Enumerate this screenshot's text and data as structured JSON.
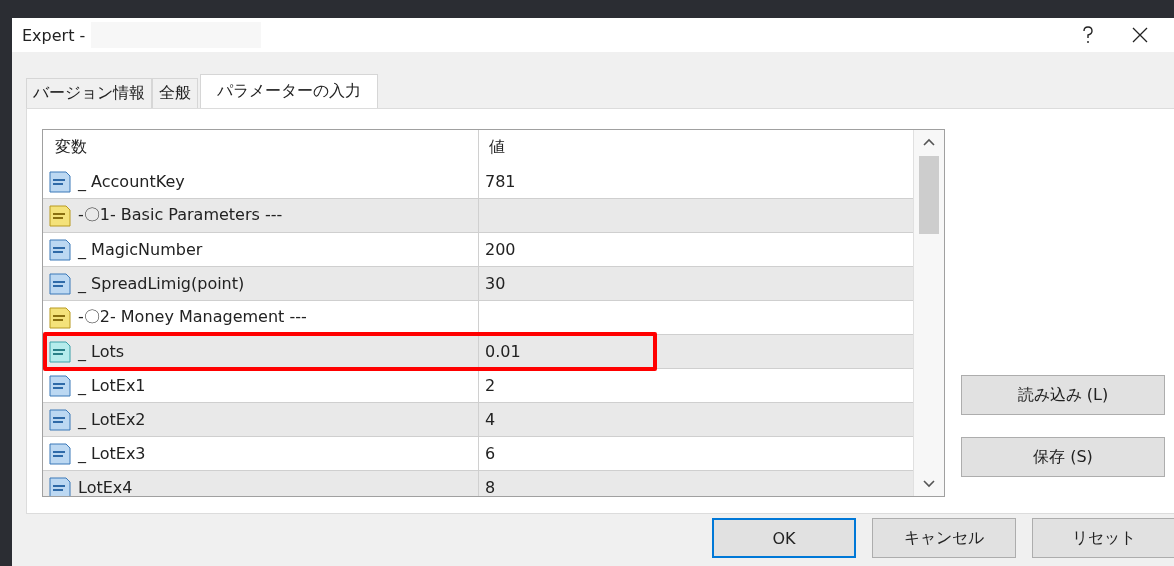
{
  "window": {
    "title": "Expert -"
  },
  "tabs": [
    {
      "label": "バージョン情報",
      "selected": false
    },
    {
      "label": "全般",
      "selected": false
    },
    {
      "label": "パラメーターの入力",
      "selected": true
    }
  ],
  "table": {
    "columns": [
      "変数",
      "値"
    ],
    "rows": [
      {
        "kind": "int",
        "name": "_ AccountKey",
        "value": "781",
        "highlighted": false
      },
      {
        "kind": "string",
        "name": "-〇1- Basic Parameters ---",
        "value": "",
        "highlighted": false
      },
      {
        "kind": "int",
        "name": "_ MagicNumber",
        "value": "200",
        "highlighted": false
      },
      {
        "kind": "int",
        "name": "_ SpreadLimig(point)",
        "value": "30",
        "highlighted": false
      },
      {
        "kind": "string",
        "name": "-〇2- Money Management ---",
        "value": "",
        "highlighted": false
      },
      {
        "kind": "double",
        "name": "_ Lots",
        "value": "0.01",
        "highlighted": true
      },
      {
        "kind": "int",
        "name": "_ LotEx1",
        "value": "2",
        "highlighted": false
      },
      {
        "kind": "int",
        "name": "_ LotEx2",
        "value": "4",
        "highlighted": false
      },
      {
        "kind": "int",
        "name": "_ LotEx3",
        "value": "6",
        "highlighted": false
      },
      {
        "kind": "int",
        "name": "LotEx4",
        "value": "8",
        "highlighted": false
      }
    ]
  },
  "side_buttons": [
    "読み込み (L)",
    "保存 (S)"
  ],
  "buttons": [
    {
      "label": "OK",
      "default": true
    },
    {
      "label": "キャンセル",
      "default": false
    },
    {
      "label": "リセット",
      "default": false
    }
  ]
}
